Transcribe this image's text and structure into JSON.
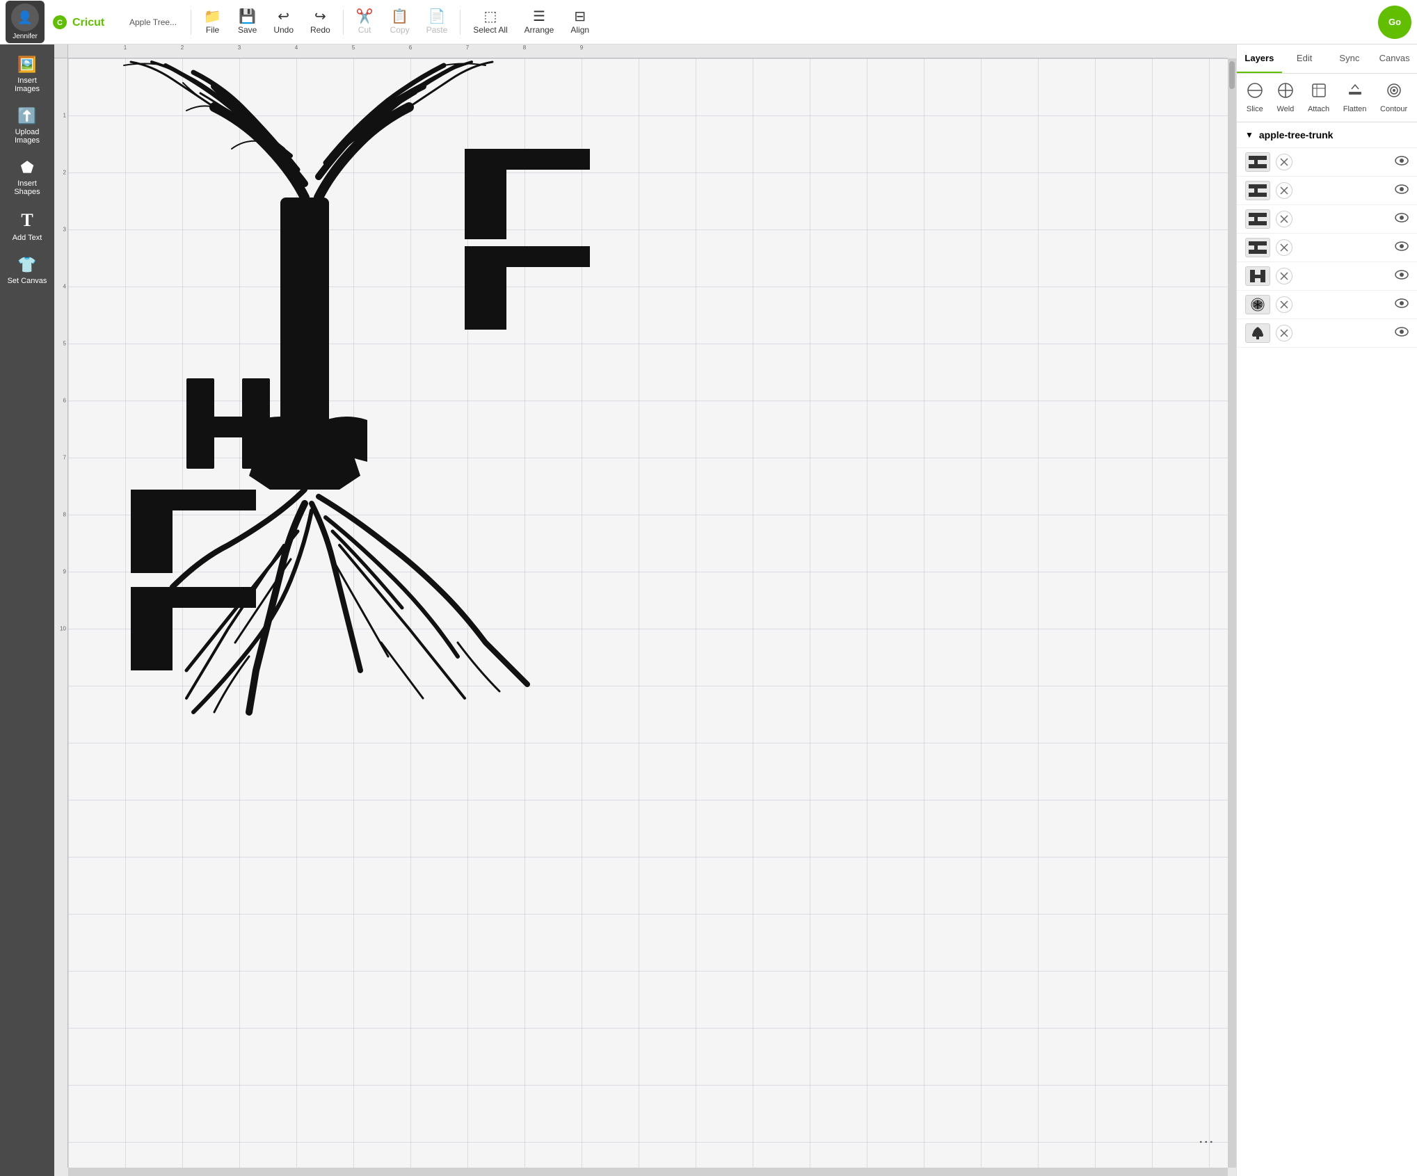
{
  "topbar": {
    "user_name": "Jennifer",
    "file_label": "File",
    "project_name": "Apple Tree...",
    "save_label": "Save",
    "undo_label": "Undo",
    "redo_label": "Redo",
    "cut_label": "Cut",
    "copy_label": "Copy",
    "paste_label": "Paste",
    "select_all_label": "Select All",
    "arrange_label": "Arrange",
    "align_label": "Align",
    "go_label": "Go"
  },
  "sidebar": {
    "items": [
      {
        "id": "insert-images",
        "label": "Insert\nImages",
        "icon": "🖼️"
      },
      {
        "id": "upload-images",
        "label": "Upload\nImages",
        "icon": "⬆️"
      },
      {
        "id": "insert-shapes",
        "label": "Insert\nShapes",
        "icon": "⬟"
      },
      {
        "id": "add-text",
        "label": "Add Text",
        "icon": "T"
      },
      {
        "id": "set-canvas",
        "label": "Set Canvas",
        "icon": "👕"
      }
    ]
  },
  "panel": {
    "tabs": [
      {
        "id": "layers",
        "label": "Layers",
        "active": true
      },
      {
        "id": "edit",
        "label": "Edit",
        "active": false
      },
      {
        "id": "sync",
        "label": "Sync",
        "active": false
      },
      {
        "id": "canvas",
        "label": "Canvas",
        "active": false
      }
    ],
    "tools": [
      {
        "id": "slice",
        "label": "Slice",
        "icon": "⊖",
        "disabled": false
      },
      {
        "id": "weld",
        "label": "Weld",
        "icon": "⊕",
        "disabled": false
      },
      {
        "id": "attach",
        "label": "Attach",
        "icon": "📎",
        "disabled": false
      },
      {
        "id": "flatten",
        "label": "Flatten",
        "icon": "⬇",
        "disabled": false
      },
      {
        "id": "contour",
        "label": "Contour",
        "icon": "◎",
        "disabled": false
      }
    ],
    "group_name": "apple-tree-trunk",
    "layers": [
      {
        "id": 1,
        "thumb_text": "🪟",
        "has_x": true,
        "visible": true
      },
      {
        "id": 2,
        "thumb_text": "🪟",
        "has_x": true,
        "visible": true
      },
      {
        "id": 3,
        "thumb_text": "🪟",
        "has_x": true,
        "visible": true
      },
      {
        "id": 4,
        "thumb_text": "🪟",
        "has_x": true,
        "visible": true
      },
      {
        "id": 5,
        "thumb_text": "H",
        "has_x": true,
        "visible": true
      },
      {
        "id": 6,
        "thumb_text": "🌿",
        "has_x": true,
        "visible": true
      },
      {
        "id": 7,
        "thumb_text": "🌲",
        "has_x": true,
        "visible": true
      }
    ]
  },
  "canvas": {
    "ruler_top_marks": [
      "1",
      "2",
      "3",
      "4",
      "5",
      "6",
      "7",
      "8",
      "9"
    ],
    "ruler_left_marks": [
      "1",
      "2",
      "3",
      "4",
      "5",
      "6",
      "7",
      "8",
      "9",
      "10"
    ]
  }
}
